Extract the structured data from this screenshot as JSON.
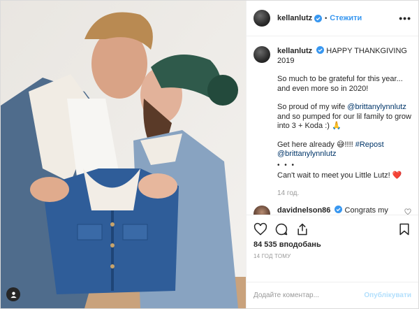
{
  "post": {
    "username": "kellanlutz",
    "follow_label": "Стежити",
    "separator": "•",
    "more_label": "•••"
  },
  "caption": {
    "username": "kellanlutz",
    "line1": "HAPPY THANKGIVING",
    "line1b": "2019",
    "p2": "So much to be grateful for this year... and even more so in 2020!",
    "p3a": "So proud of my wife ",
    "p3_mention": "@brittanylynnlutz",
    "p3b": " and so pumped for our lil family to grow into 3 + Koda :) 🙏",
    "p4a": "Get here already 😅!!!! ",
    "p4_hashtag": "#Repost",
    "p4_mention": "@brittanylynnlutz",
    "dots": "• • •",
    "p5": "Can't wait to meet you Little Lutz! ❤️",
    "time": "14 год."
  },
  "comment": {
    "username": "davidnelson86",
    "text": "Congrats my man! I guess that baby dust is real! 😊😎👫"
  },
  "actions": {
    "likes": "84 535 вподобань",
    "when": "14 год тому",
    "add_comment_placeholder": "Додайте коментар...",
    "publish_label": "Опублікувати"
  },
  "colors": {
    "accent": "#3897f0",
    "link": "#003569",
    "muted": "#999999",
    "heart": "#ed4956"
  },
  "icons": [
    "verified-icon",
    "heart-icon",
    "comment-icon",
    "share-icon",
    "bookmark-icon",
    "more-icon",
    "user-tag-icon"
  ]
}
